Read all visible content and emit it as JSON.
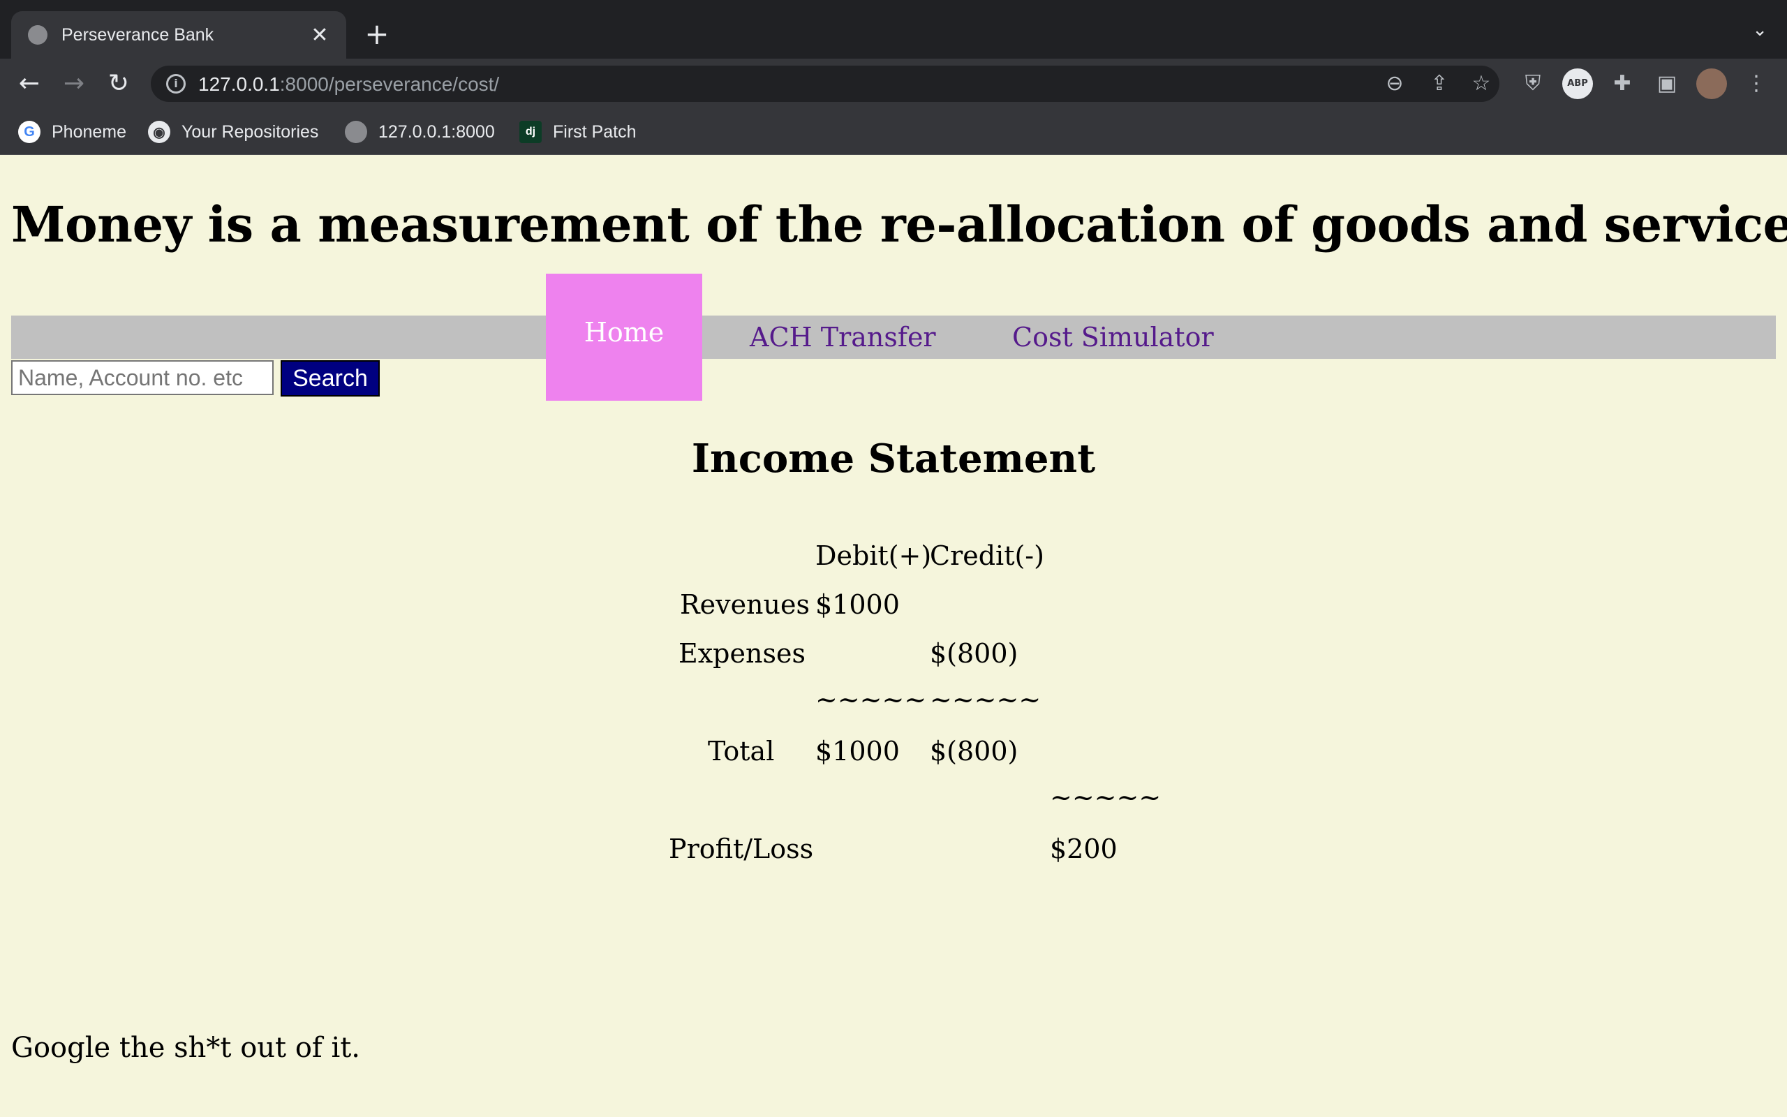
{
  "browser": {
    "tab_title": "Perseverance Bank",
    "url_host": "127.0.0.1",
    "url_path": ":8000/perseverance/cost/",
    "bookmarks": [
      {
        "label": "Phoneme",
        "icon": "google-icon"
      },
      {
        "label": "Your Repositories",
        "icon": "github-icon"
      },
      {
        "label": "127.0.0.1:8000",
        "icon": "globe-icon"
      },
      {
        "label": "First Patch",
        "icon": "django-icon"
      }
    ],
    "ext_abp_label": "ABP"
  },
  "page": {
    "headline": "Money is a measurement of the re-allocation of goods and services",
    "nav": {
      "home": "Home",
      "ach": "ACH Transfer",
      "cost": "Cost Simulator"
    },
    "search": {
      "placeholder": "Name, Account no. etc",
      "button": "Search"
    },
    "statement": {
      "title": "Income Statement",
      "debit_header": "Debit(+)",
      "credit_header": "Credit(-)",
      "revenues_label": "Revenues",
      "revenues_debit": "$1000",
      "expenses_label": "Expenses",
      "expenses_credit": "$(800)",
      "separator": "~~~~~",
      "total_label": "Total",
      "total_debit": "$1000",
      "total_credit": "$(800)",
      "profit_label": "Profit/Loss",
      "profit_value": "$200"
    },
    "footer": {
      "line1": "Google the sh*t out of it."
    }
  },
  "colors": {
    "page_bg": "#f5f5dc",
    "navbar_bg": "#c0c0c0",
    "home_bg": "#ee82ee",
    "link": "#551a8b",
    "search_button_bg": "#000080"
  }
}
